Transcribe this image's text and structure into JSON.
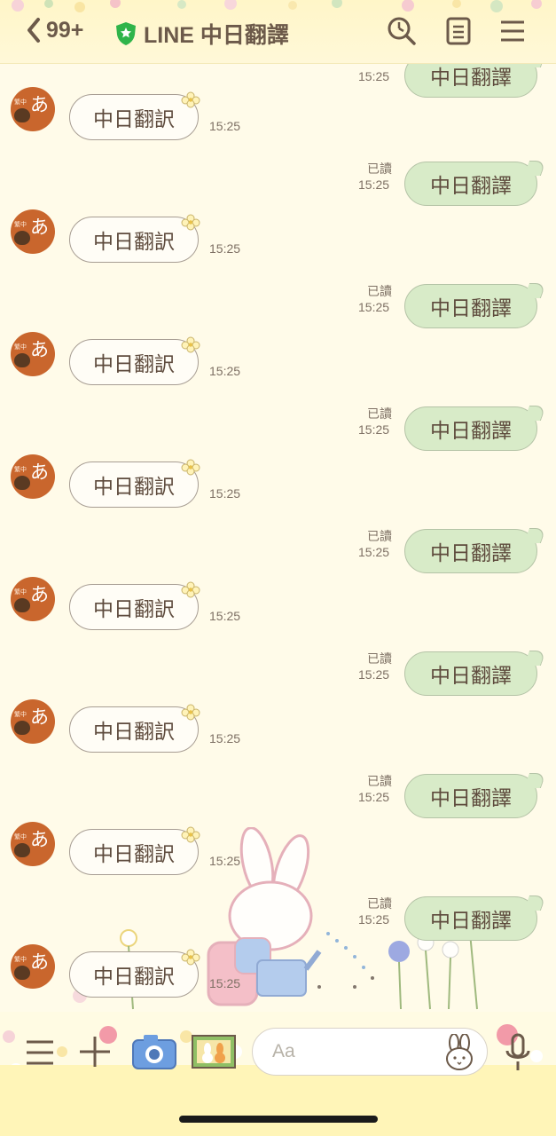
{
  "header": {
    "unread_count": "99+",
    "title": "LINE 中日翻譯"
  },
  "messages": [
    {
      "type": "out",
      "text": "中日翻譯",
      "read": "",
      "time": "15:25",
      "partial": true
    },
    {
      "type": "in",
      "text": "中日翻訳",
      "time": "15:25"
    },
    {
      "type": "out",
      "text": "中日翻譯",
      "read": "已讀",
      "time": "15:25"
    },
    {
      "type": "in",
      "text": "中日翻訳",
      "time": "15:25"
    },
    {
      "type": "out",
      "text": "中日翻譯",
      "read": "已讀",
      "time": "15:25"
    },
    {
      "type": "in",
      "text": "中日翻訳",
      "time": "15:25"
    },
    {
      "type": "out",
      "text": "中日翻譯",
      "read": "已讀",
      "time": "15:25"
    },
    {
      "type": "in",
      "text": "中日翻訳",
      "time": "15:25"
    },
    {
      "type": "out",
      "text": "中日翻譯",
      "read": "已讀",
      "time": "15:25"
    },
    {
      "type": "in",
      "text": "中日翻訳",
      "time": "15:25"
    },
    {
      "type": "out",
      "text": "中日翻譯",
      "read": "已讀",
      "time": "15:25"
    },
    {
      "type": "in",
      "text": "中日翻訳",
      "time": "15:25"
    },
    {
      "type": "out",
      "text": "中日翻譯",
      "read": "已讀",
      "time": "15:25"
    },
    {
      "type": "in",
      "text": "中日翻訳",
      "time": "15:25"
    },
    {
      "type": "out",
      "text": "中日翻譯",
      "read": "已讀",
      "time": "15:25"
    },
    {
      "type": "in",
      "text": "中日翻訳",
      "time": "15:25"
    }
  ],
  "avatar": {
    "kana": "あ",
    "tag": "繁中"
  },
  "input": {
    "placeholder": "Aa"
  },
  "colors": {
    "incoming_bubble": "#fffdf6",
    "outgoing_bubble": "#d8ebc8",
    "avatar": "#c9662d",
    "text": "#5e4b3d",
    "background": "#fffbe9"
  },
  "icons": [
    "back-chevron-icon",
    "verified-shield-icon",
    "search-icon",
    "notes-icon",
    "menu-icon",
    "list-icon",
    "plus-icon",
    "camera-icon",
    "photo-icon",
    "emoji-bunny-icon",
    "microphone-icon"
  ]
}
